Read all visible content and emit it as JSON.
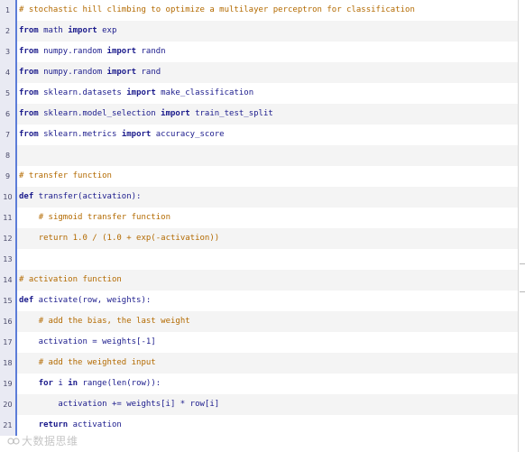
{
  "code_view": {
    "lines": [
      {
        "num": "1",
        "tokens": [
          {
            "t": "comment",
            "v": "# stochastic hill climbing to optimize a multilayer perceptron for classification"
          }
        ]
      },
      {
        "num": "2",
        "tokens": [
          {
            "t": "keyword",
            "v": "from"
          },
          {
            "t": "plain",
            "v": " math "
          },
          {
            "t": "keyword",
            "v": "import"
          },
          {
            "t": "plain",
            "v": " exp"
          }
        ]
      },
      {
        "num": "3",
        "tokens": [
          {
            "t": "keyword",
            "v": "from"
          },
          {
            "t": "plain",
            "v": " numpy.random "
          },
          {
            "t": "keyword",
            "v": "import"
          },
          {
            "t": "plain",
            "v": " randn"
          }
        ]
      },
      {
        "num": "4",
        "tokens": [
          {
            "t": "keyword",
            "v": "from"
          },
          {
            "t": "plain",
            "v": " numpy.random "
          },
          {
            "t": "keyword",
            "v": "import"
          },
          {
            "t": "plain",
            "v": " rand"
          }
        ]
      },
      {
        "num": "5",
        "tokens": [
          {
            "t": "keyword",
            "v": "from"
          },
          {
            "t": "plain",
            "v": " sklearn.datasets "
          },
          {
            "t": "keyword",
            "v": "import"
          },
          {
            "t": "plain",
            "v": " make_classification"
          }
        ]
      },
      {
        "num": "6",
        "tokens": [
          {
            "t": "keyword",
            "v": "from"
          },
          {
            "t": "plain",
            "v": " sklearn.model_selection "
          },
          {
            "t": "keyword",
            "v": "import"
          },
          {
            "t": "plain",
            "v": " train_test_split"
          }
        ]
      },
      {
        "num": "7",
        "tokens": [
          {
            "t": "keyword",
            "v": "from"
          },
          {
            "t": "plain",
            "v": " sklearn.metrics "
          },
          {
            "t": "keyword",
            "v": "import"
          },
          {
            "t": "plain",
            "v": " accuracy_score"
          }
        ]
      },
      {
        "num": "8",
        "tokens": []
      },
      {
        "num": "9",
        "tokens": [
          {
            "t": "comment",
            "v": "# transfer function"
          }
        ]
      },
      {
        "num": "10",
        "tokens": [
          {
            "t": "keyword",
            "v": "def"
          },
          {
            "t": "plain",
            "v": " transfer(activation):"
          }
        ]
      },
      {
        "num": "11",
        "tokens": [
          {
            "t": "plain",
            "v": "    "
          },
          {
            "t": "comment",
            "v": "# sigmoid transfer function"
          }
        ]
      },
      {
        "num": "12",
        "tokens": [
          {
            "t": "plain",
            "v": "    "
          },
          {
            "t": "comment",
            "v": "return 1.0 / (1.0 + exp(-activation))"
          }
        ]
      },
      {
        "num": "13",
        "tokens": []
      },
      {
        "num": "14",
        "tokens": [
          {
            "t": "comment",
            "v": "# activation function"
          }
        ]
      },
      {
        "num": "15",
        "tokens": [
          {
            "t": "keyword",
            "v": "def"
          },
          {
            "t": "plain",
            "v": " activate(row, weights):"
          }
        ]
      },
      {
        "num": "16",
        "tokens": [
          {
            "t": "plain",
            "v": "    "
          },
          {
            "t": "comment",
            "v": "# add the bias, the last weight"
          }
        ]
      },
      {
        "num": "17",
        "tokens": [
          {
            "t": "plain",
            "v": "    activation = weights[-1]"
          }
        ]
      },
      {
        "num": "18",
        "tokens": [
          {
            "t": "plain",
            "v": "    "
          },
          {
            "t": "comment",
            "v": "# add the weighted input"
          }
        ]
      },
      {
        "num": "19",
        "tokens": [
          {
            "t": "plain",
            "v": "    "
          },
          {
            "t": "keyword",
            "v": "for"
          },
          {
            "t": "plain",
            "v": " i "
          },
          {
            "t": "keyword",
            "v": "in"
          },
          {
            "t": "plain",
            "v": " range(len(row)):"
          }
        ]
      },
      {
        "num": "20",
        "tokens": [
          {
            "t": "plain",
            "v": "        activation += weights[i] * row[i]"
          }
        ]
      },
      {
        "num": "21",
        "tokens": [
          {
            "t": "plain",
            "v": "    "
          },
          {
            "t": "keyword",
            "v": "return"
          },
          {
            "t": "plain",
            "v": " activation"
          }
        ]
      }
    ]
  },
  "watermark": {
    "text": "大数据思维"
  },
  "colors": {
    "gutter_bg": "#e9eaf3",
    "gutter_border": "#5b7cd8",
    "code_text": "#1b1b8c",
    "comment_text": "#b36a00",
    "row_alt_bg": "#f4f4f4"
  }
}
